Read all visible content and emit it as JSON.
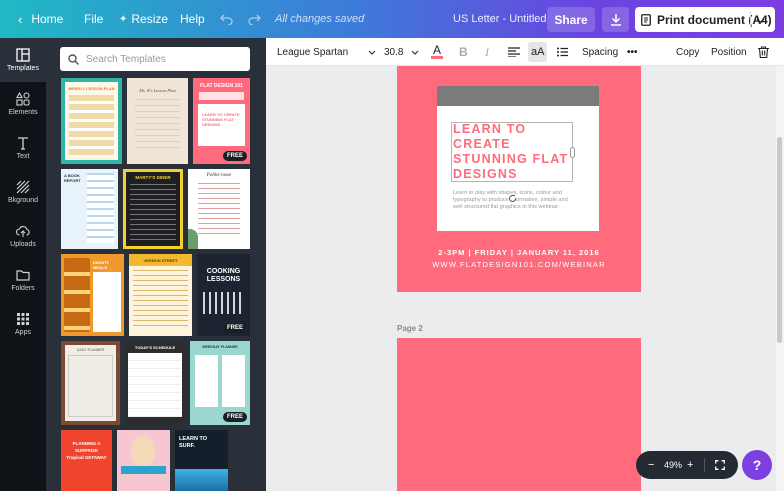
{
  "topbar": {
    "home_label": "Home",
    "file_label": "File",
    "resize_label": "Resize",
    "help_label": "Help",
    "save_status": "All changes saved",
    "doc_title": "US Letter - Untitled",
    "share_label": "Share",
    "print_label": "Print document (A4)"
  },
  "rail": {
    "items": [
      {
        "label": "Templates",
        "icon": "templates-icon"
      },
      {
        "label": "Elements",
        "icon": "elements-icon"
      },
      {
        "label": "Text",
        "icon": "text-icon"
      },
      {
        "label": "Bkground",
        "icon": "background-icon"
      },
      {
        "label": "Uploads",
        "icon": "uploads-icon"
      },
      {
        "label": "Folders",
        "icon": "folder-icon"
      },
      {
        "label": "Apps",
        "icon": "apps-icon"
      }
    ]
  },
  "panel": {
    "search_placeholder": "Search Templates",
    "free_badge": "FREE",
    "thumbs": {
      "t1": "WEEKLY LESSON PLAN",
      "t2": "Ms. R's Lesson Plan",
      "t3_title": "FLAT DESIGN 101",
      "t3_body": "LEARN TO CREATE STUNNING FLAT DESIGNS",
      "t4": "A BOOK REPORT",
      "t5": "MARTY'S DINER",
      "t6": "Poblecrasse",
      "t7": "DIGNITY MEALS",
      "t8": "VERNON STREET",
      "t9": "COOKING LESSONS",
      "t10": "DAILY PLANNER",
      "t11": "TODAY'S SCHEDULE",
      "t12": "WEEKDAY PLANNER",
      "t13": "PLANNING A SURPRISE Tropical GETAWAY",
      "t15": "LEARN TO SURF."
    }
  },
  "toolbar": {
    "font_name": "League Spartan",
    "font_size": "30.8",
    "text_color": "#ff6b7d",
    "aa_label": "aA",
    "spacing_label": "Spacing",
    "more_label": "•••",
    "copy_label": "Copy",
    "position_label": "Position"
  },
  "canvas": {
    "title_text": "LEARN TO CREATE STUNNING FLAT DESIGNS",
    "body_text": "Learn to play with shapes, icons, colour and typography to produce informative, simple and well structured flat graphics in this webinar.",
    "date_text": "2-3PM | FRIDAY | JANUARY 11, 2016",
    "url_text": "WWW.FLATDESIGN101.COM/WEBINAR",
    "page2_label": "Page 2",
    "page_color": "#ff6b7d"
  },
  "zoom": {
    "minus": "−",
    "value": "49%",
    "plus": "+"
  },
  "help_button": "?"
}
